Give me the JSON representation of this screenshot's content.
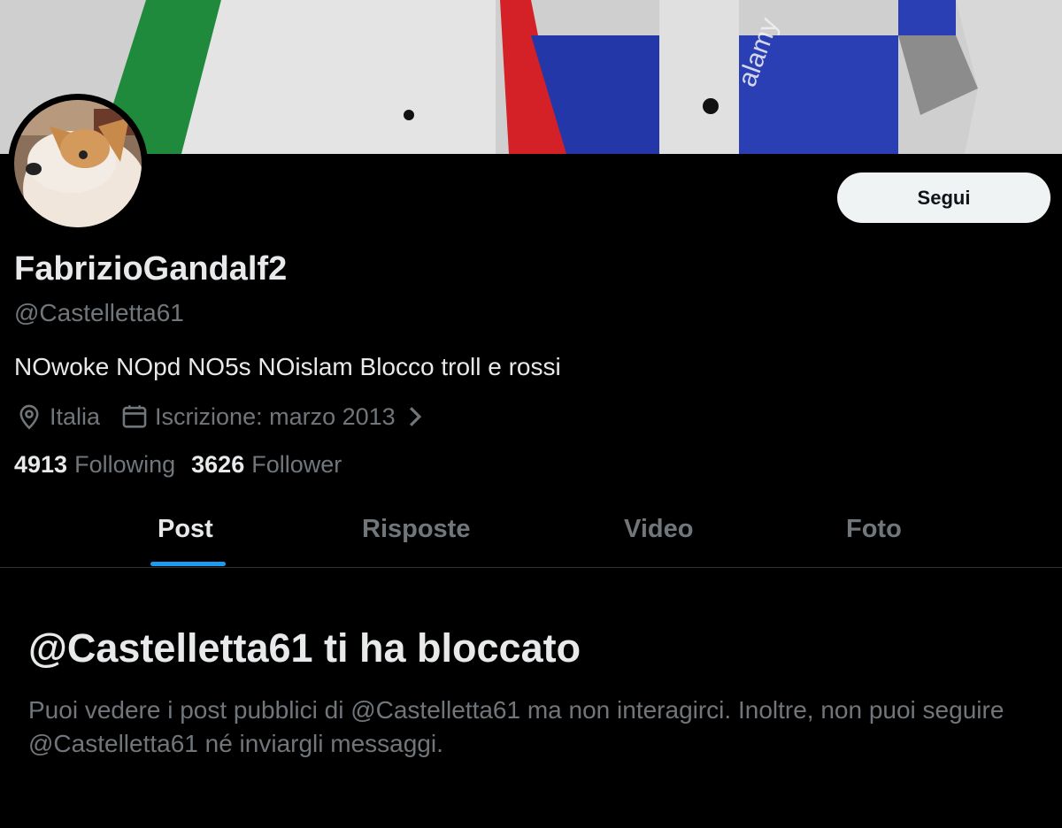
{
  "banner": {
    "watermark": "alamy"
  },
  "profile": {
    "display_name": "FabrizioGandalf2",
    "handle": "@Castelletta61",
    "bio": "NOwoke NOpd NO5s NOislam Blocco troll e rossi",
    "location": "Italia",
    "joined": "Iscrizione: marzo 2013",
    "following_count": "4913",
    "following_label": "Following",
    "follower_count": "3626",
    "follower_label": "Follower"
  },
  "actions": {
    "follow_label": "Segui"
  },
  "tabs": [
    {
      "label": "Post",
      "active": true
    },
    {
      "label": "Risposte",
      "active": false
    },
    {
      "label": "Video",
      "active": false
    },
    {
      "label": "Foto",
      "active": false
    }
  ],
  "blocked": {
    "title": "@Castelletta61 ti ha bloccato",
    "description": "Puoi vedere i post pubblici di @Castelletta61 ma non interagirci. Inoltre, non puoi seguire @Castelletta61 né inviargli messaggi."
  },
  "icons": {
    "location": "location-pin-icon",
    "calendar": "calendar-icon",
    "chevron": "chevron-right-icon"
  },
  "colors": {
    "background": "#000000",
    "primary_text": "#e7e9ea",
    "secondary_text": "#71767b",
    "accent": "#1d9bf0",
    "button_bg": "#eff3f4"
  }
}
